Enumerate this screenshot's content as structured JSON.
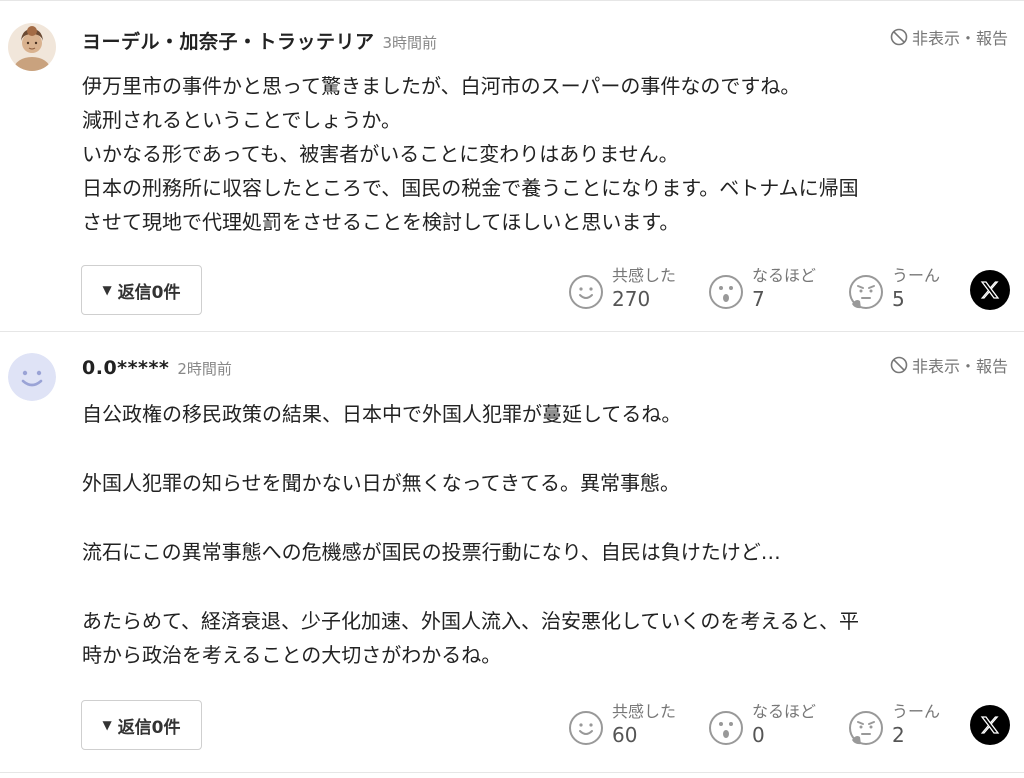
{
  "comments": [
    {
      "author": "ヨーデル・加奈子・トラッテリア",
      "time": "3時間前",
      "hide_report": "非表示・報告",
      "lines": [
        "伊万里市の事件かと思って驚きましたが、白河市のスーパーの事件なのですね。",
        "減刑されるということでしょうか。",
        "いかなる形であっても、被害者がいることに変わりはありません。",
        "日本の刑務所に収容したところで、国民の税金で養うことになります。ベトナムに帰国",
        "させて現地で代理処罰をさせることを検討してほしいと思います。"
      ],
      "reply_label": "返信0件",
      "reactions": [
        {
          "label": "共感した",
          "count": "270",
          "icon": "smile-face-icon"
        },
        {
          "label": "なるほど",
          "count": "7",
          "icon": "surprised-face-icon"
        },
        {
          "label": "うーん",
          "count": "5",
          "icon": "thinking-face-icon"
        }
      ],
      "share_icon": "x-logo-icon"
    },
    {
      "author": "0.0*****",
      "time": "2時間前",
      "hide_report": "非表示・報告",
      "lines": [
        "自公政権の移民政策の結果、日本中で外国人犯罪が蔓延してるね。",
        "",
        "外国人犯罪の知らせを聞かない日が無くなってきてる。異常事態。",
        "",
        "流石にこの異常事態への危機感が国民の投票行動になり、自民は負けたけど…",
        "",
        "あたらめて、経済衰退、少子化加速、外国人流入、治安悪化していくのを考えると、平",
        "時から政治を考えることの大切さがわかるね。"
      ],
      "reply_label": "返信0件",
      "reactions": [
        {
          "label": "共感した",
          "count": "60",
          "icon": "smile-face-icon"
        },
        {
          "label": "なるほど",
          "count": "0",
          "icon": "surprised-face-icon"
        },
        {
          "label": "うーん",
          "count": "2",
          "icon": "thinking-face-icon"
        }
      ],
      "share_icon": "x-logo-icon"
    }
  ],
  "colors": {
    "text": "#222222",
    "muted": "#777777",
    "border": "#e6e6e6",
    "avatar_default_bg": "#dfe3f6",
    "avatar_default_face": "#9aa3d6"
  }
}
